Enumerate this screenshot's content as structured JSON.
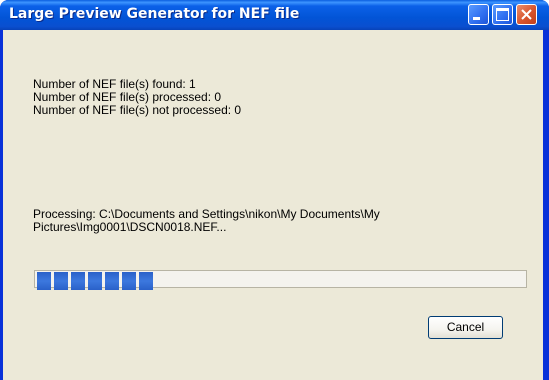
{
  "window": {
    "title": "Large Preview Generator for NEF file"
  },
  "stats": {
    "found": "Number of NEF file(s) found: 1",
    "processed": "Number of NEF file(s) processed: 0",
    "not_processed": "Number of NEF file(s) not processed: 0"
  },
  "processing": {
    "line1": "Processing: C:\\Documents and Settings\\nikon\\My Documents\\My",
    "line2": "Pictures\\Img0001\\DSCN0018.NEF..."
  },
  "progress": {
    "blocks_filled": 7,
    "fraction": 0.26,
    "color": "#2a61c9"
  },
  "buttons": {
    "cancel_label": "Cancel"
  },
  "icons": {
    "minimize": "minimize-icon",
    "maximize": "maximize-icon",
    "close": "close-icon"
  }
}
